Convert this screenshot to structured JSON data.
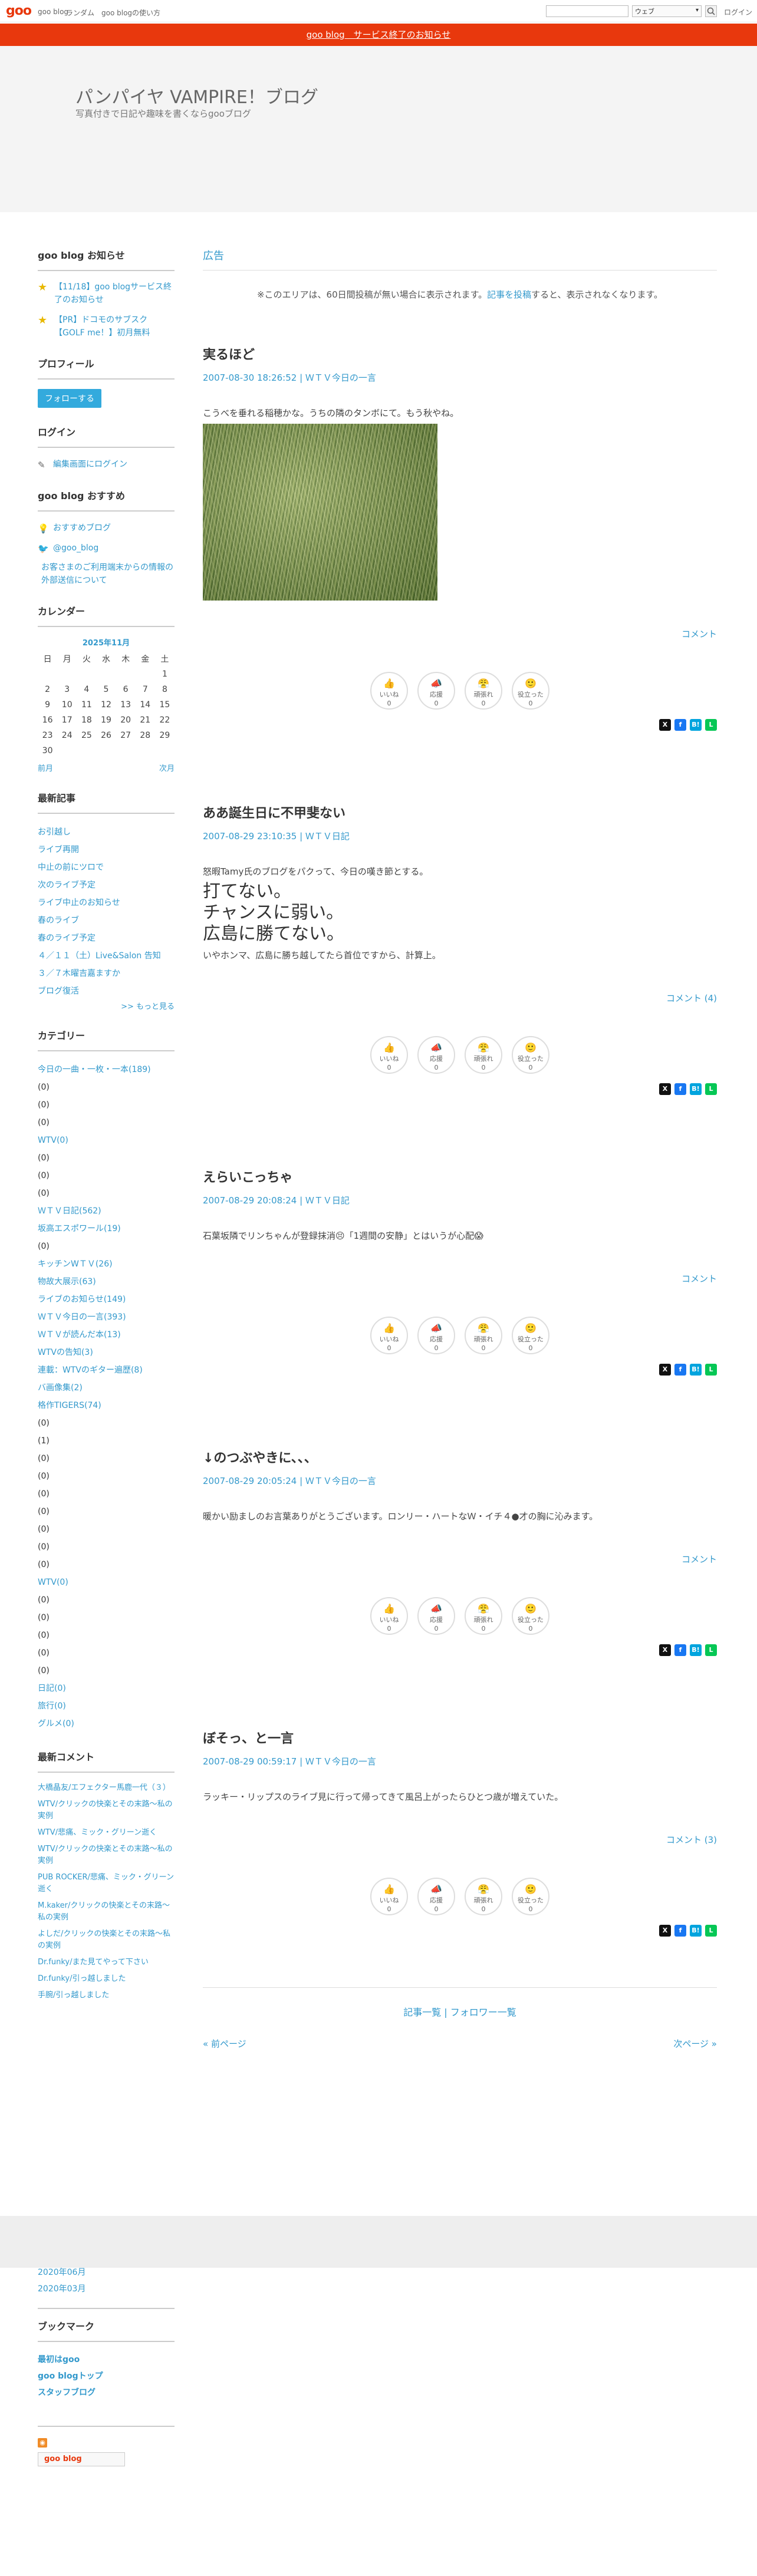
{
  "topnav": {
    "logo": "goo",
    "links": [
      "goo blog",
      "ランダム",
      "goo blogの使い方"
    ],
    "search_placeholder": "",
    "search_scope": "ウェブ",
    "login": "ログイン"
  },
  "banner": "goo blog　サービス終了のお知らせ",
  "header": {
    "title": "パンパイヤ VAMPIRE！ブログ",
    "description": "写真付きで日記や趣味を書くならgooブログ"
  },
  "sidebar": {
    "notice": {
      "title": "goo blog お知らせ",
      "items": [
        "【11/18】goo blogサービス終了のお知らせ",
        "【PR】ドコモのサブスク【GOLF me！】初月無料"
      ]
    },
    "profile": {
      "title": "プロフィール",
      "follow": "フォローする"
    },
    "login": {
      "title": "ログイン",
      "edit": "編集画面にログイン"
    },
    "recommend": {
      "title": "goo blog おすすめ",
      "items": [
        "おすすめブログ",
        "@goo_blog"
      ],
      "note": "お客さまのご利用端末からの情報の外部送信について"
    },
    "calendar": {
      "title": "カレンダー",
      "month": "2025年11月",
      "weekdays": [
        "日",
        "月",
        "火",
        "水",
        "木",
        "金",
        "土"
      ],
      "weeks": [
        [
          "",
          "",
          "",
          "",
          "",
          "",
          "1"
        ],
        [
          "2",
          "3",
          "4",
          "5",
          "6",
          "7",
          "8"
        ],
        [
          "9",
          "10",
          "11",
          "12",
          "13",
          "14",
          "15"
        ],
        [
          "16",
          "17",
          "18",
          "19",
          "20",
          "21",
          "22"
        ],
        [
          "23",
          "24",
          "25",
          "26",
          "27",
          "28",
          "29"
        ],
        [
          "30",
          "",
          "",
          "",
          "",
          "",
          ""
        ]
      ],
      "prev": "前月",
      "next": "次月"
    },
    "recent": {
      "title": "最新記事",
      "items": [
        "お引越し",
        "ライブ再開",
        "中止の前にツロで",
        "次のライブ予定",
        "ライブ中止のお知らせ",
        "春のライブ",
        "春のライブ予定",
        "４／１１（土）Live&Salon 告知",
        "３／７木曜吉嘉ますか",
        "ブログ復活"
      ],
      "more": ">> もっと見る"
    },
    "categories": {
      "title": "カテゴリー",
      "items": [
        "今日の一曲・一枚・一本(189)",
        "(0)",
        "(0)",
        "(0)",
        "WTV(0)",
        "(0)",
        "(0)",
        "(0)",
        "ＷＴＶ日記(562)",
        "坂高エスポワール(19)",
        "(0)",
        "キッチンWＴＶ(26)",
        "物故大展示(63)",
        "ライブのお知らせ(149)",
        "ＷＴＶ今日の一言(393)",
        "ＷＴＶが読んだ本(13)",
        "WTVの告知(3)",
        "連載：WTVのギター遍歴(8)",
        "バ画像集(2)",
        "格作TIGERS(74)",
        "(0)",
        "(1)",
        "(0)",
        "(0)",
        "(0)",
        "(0)",
        "(0)",
        "(0)",
        "(0)",
        "WTV(0)",
        "(0)",
        "(0)",
        "(0)",
        "(0)",
        "(0)",
        "日記(0)",
        "旅行(0)",
        "グルメ(0)"
      ]
    },
    "comments": {
      "title": "最新コメント",
      "items": [
        "大橋晶友/エフェクター馬鹿一代（３）",
        "WTV/クリックの快楽とその末路～私の実例",
        "WTV/悲痛、ミック・グリーン逝く",
        "WTV/クリックの快楽とその末路～私の実例",
        "PUB ROCKER/悲痛、ミック・グリーン逝く",
        "M.kaker/クリックの快楽とその末路～私の実例",
        "よしだ/クリックの快楽とその末路～私の実例",
        "Dr.funky/また見てやって下さい",
        "Dr.funky/引っ越しました",
        "手腕/引っ越しました"
      ]
    },
    "archives": [
      "2020年06月",
      "2020年03月"
    ],
    "bookmark": {
      "title": "ブックマーク",
      "items": [
        "最初はgoo",
        "goo blogトップ",
        "スタッフブログ"
      ]
    },
    "goo_button": "goo blog"
  },
  "main": {
    "ad_title": "広告",
    "ad_note": "※このエリアは、60日間投稿が無い場合に表示されます。",
    "ad_note_link": "記事を投稿",
    "ad_note_tail": "すると、表示されなくなります。",
    "reactions": [
      "いいね",
      "応援",
      "頑張れ",
      "役立った"
    ],
    "posts": [
      {
        "title": "実るほど",
        "meta": "2007-08-30 18:26:52 | ＷＴＶ今日の一言",
        "body": "こうべを垂れる稲穂かな。うちの隣のタンボにて。もう秋やね。",
        "comment": "コメント",
        "counts": [
          "0",
          "0",
          "0",
          "0"
        ]
      },
      {
        "title": "ああ誕生日に不甲斐ない",
        "meta": "2007-08-29 23:10:35 | ＷＴＶ日記",
        "body": "怒暇Tamy氏のブログをパクって、今日の嘆き節とする。",
        "big": [
          "打てない。",
          "チャンスに弱い。",
          "広島に勝てない。"
        ],
        "tail": "いやホンマ、広島に勝ち越してたら首位ですから、計算上。",
        "comment": "コメント (4)",
        "counts": [
          "0",
          "0",
          "0",
          "0"
        ]
      },
      {
        "title": "えらいこっちゃ",
        "meta": "2007-08-29 20:08:24 | ＷＴＶ日記",
        "body": "石葉坂隣でリンちゃんが登録抹消😣「1週間の安静」とはいうが心配😱",
        "comment": "コメント",
        "counts": [
          "0",
          "0",
          "0",
          "0"
        ]
      },
      {
        "title": "↓のつぶやきに、、、",
        "meta": "2007-08-29 20:05:24 | ＷＴＶ今日の一言",
        "body": "暖かい励ましのお言葉ありがとうございます。ロンリー・ハートなＷ・イチ４●才の胸に沁みます。",
        "comment": "コメント",
        "counts": [
          "0",
          "0",
          "0",
          "0"
        ]
      },
      {
        "title": "ぼそっ、と一言",
        "meta": "2007-08-29 00:59:17 | ＷＴＶ今日の一言",
        "body": "ラッキー・リップスのライブ見に行って帰ってきて風呂上がったらひとつ歳が増えていた。",
        "comment": "コメント (3)",
        "counts": [
          "0",
          "0",
          "0",
          "0"
        ]
      }
    ],
    "list_links": "記事一覧 | フォロワー一覧",
    "prev_page": "« 前ページ",
    "next_page": "次ページ »"
  },
  "colors": {
    "brand": "#e8380d",
    "link": "#3399cc",
    "header_bg": "#f4f4f4"
  }
}
